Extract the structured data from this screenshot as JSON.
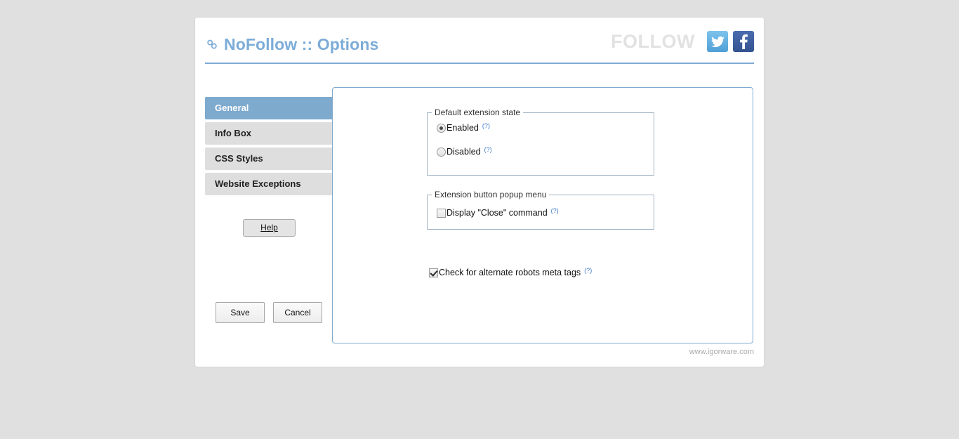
{
  "header": {
    "title": "NoFollow :: Options",
    "title_icon": "link-chain-icon",
    "follow_label": "FOLLOW",
    "social": [
      {
        "name": "twitter-icon",
        "color": "#5EA9DD"
      },
      {
        "name": "facebook-icon",
        "color": "#3B5998"
      }
    ],
    "accent_color": "#7CACD8"
  },
  "sidebar": {
    "tabs": [
      {
        "label": "General",
        "active": true
      },
      {
        "label": "Info Box",
        "active": false
      },
      {
        "label": "CSS Styles",
        "active": false
      },
      {
        "label": "Website Exceptions",
        "active": false
      }
    ],
    "help_label": "Help",
    "save_label": "Save",
    "cancel_label": "Cancel"
  },
  "panel": {
    "groups": [
      {
        "legend": "Default extension state",
        "options": [
          {
            "type": "radio",
            "label": "Enabled",
            "checked": true,
            "help": "(?)"
          },
          {
            "type": "radio",
            "label": "Disabled",
            "checked": false,
            "help": "(?)"
          }
        ]
      },
      {
        "legend": "Extension button popup menu",
        "options": [
          {
            "type": "checkbox",
            "label": "Display \"Close\" command",
            "checked": false,
            "help": "(?)"
          }
        ]
      }
    ],
    "standalone": {
      "type": "checkbox",
      "label": "Check for alternate robots meta tags",
      "checked": true,
      "help": "(?)"
    }
  },
  "footer": {
    "site": "www.igorware.com"
  }
}
